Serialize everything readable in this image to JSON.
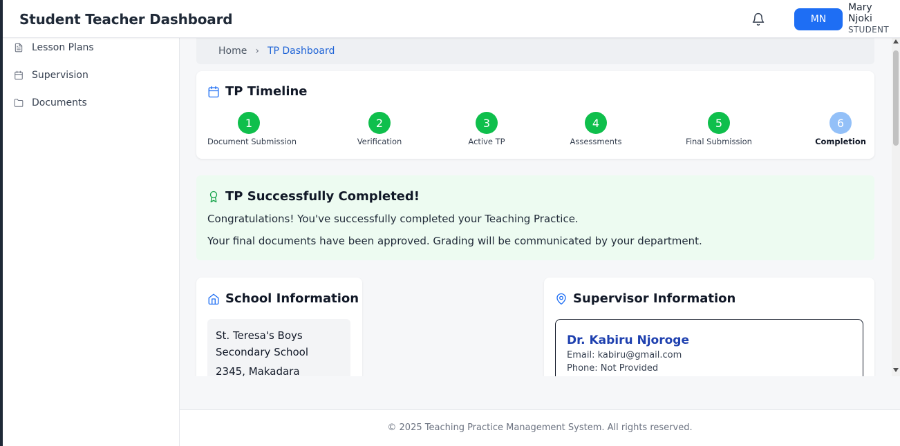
{
  "header": {
    "title": "Student Teacher Dashboard",
    "avatar_initials": "MN",
    "user_first": "Mary",
    "user_last": "Njoki",
    "user_role": "STUDENT"
  },
  "sidebar": {
    "items": [
      {
        "label": "Lesson Plans",
        "icon": "document-icon"
      },
      {
        "label": "Supervision",
        "icon": "calendar-icon"
      },
      {
        "label": "Documents",
        "icon": "folder-icon"
      }
    ]
  },
  "breadcrumb": {
    "home": "Home",
    "current": "TP Dashboard"
  },
  "timeline": {
    "title": "TP Timeline",
    "steps": [
      {
        "number": "1",
        "label": "Document Submission",
        "status": "complete"
      },
      {
        "number": "2",
        "label": "Verification",
        "status": "complete"
      },
      {
        "number": "3",
        "label": "Active TP",
        "status": "complete"
      },
      {
        "number": "4",
        "label": "Assessments",
        "status": "complete"
      },
      {
        "number": "5",
        "label": "Final Submission",
        "status": "complete"
      },
      {
        "number": "6",
        "label": "Completion",
        "status": "current"
      }
    ]
  },
  "success": {
    "title": "TP Successfully Completed!",
    "line1": "Congratulations! You've successfully completed your Teaching Practice.",
    "line2": "Your final documents have been approved. Grading will be communicated by your department."
  },
  "school": {
    "title": "School Information",
    "name_line1": "St. Teresa's Boys",
    "name_line2": "Secondary School",
    "address": "2345, Makadara"
  },
  "supervisor": {
    "title": "Supervisor Information",
    "name": "Dr. Kabiru Njoroge",
    "email": "Email: kabiru@gmail.com",
    "phone": "Phone: Not Provided"
  },
  "footer": {
    "text": "© 2025 Teaching Practice Management System. All rights reserved."
  },
  "colors": {
    "accent": "#1e6ef4",
    "step_complete": "#0fbf4c",
    "step_pending": "#93c0f8",
    "success_bg": "#edfbf1"
  }
}
